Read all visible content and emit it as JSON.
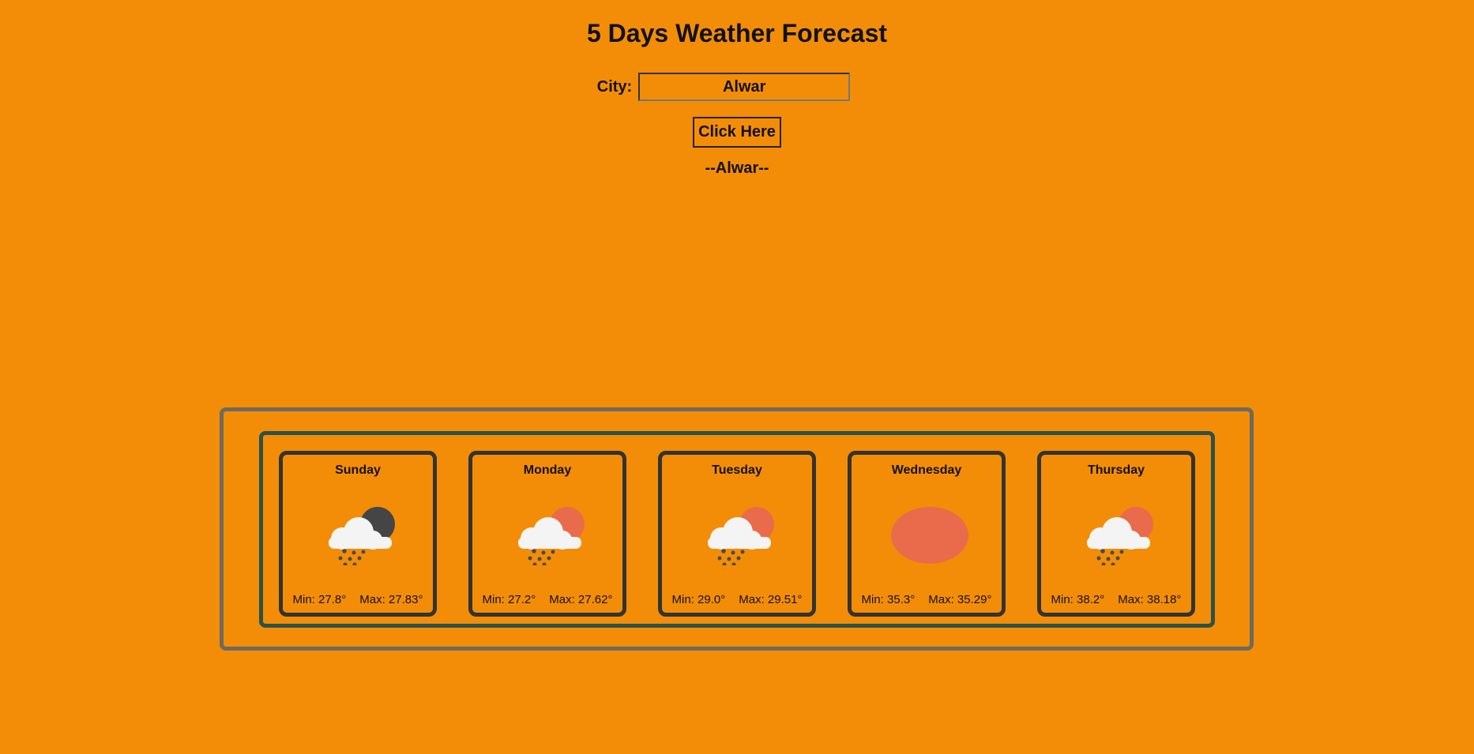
{
  "page": {
    "title": "5 Days Weather Forecast"
  },
  "search": {
    "label": "City:",
    "value": "Alwar",
    "button_label": "Click Here"
  },
  "result": {
    "city_display": "--Alwar--"
  },
  "colors": {
    "background": "#f38d07",
    "outer_border": "#6e6a5f",
    "inner_border": "#2b5249",
    "card_border": "#333333",
    "sun": "#ea6b4b",
    "moon": "#454545",
    "cloud": "#f4f4f4"
  },
  "forecast": [
    {
      "day": "Sunday",
      "icon": "night-cloud-rain-icon",
      "min": "Min: 27.8°",
      "max": "Max: 27.83°"
    },
    {
      "day": "Monday",
      "icon": "sun-cloud-rain-icon",
      "min": "Min: 27.2°",
      "max": "Max: 27.62°"
    },
    {
      "day": "Tuesday",
      "icon": "sun-cloud-rain-icon",
      "min": "Min: 29.0°",
      "max": "Max: 29.51°"
    },
    {
      "day": "Wednesday",
      "icon": "sun-icon",
      "min": "Min: 35.3°",
      "max": "Max: 35.29°"
    },
    {
      "day": "Thursday",
      "icon": "sun-cloud-rain-icon",
      "min": "Min: 38.2°",
      "max": "Max: 38.18°"
    }
  ]
}
